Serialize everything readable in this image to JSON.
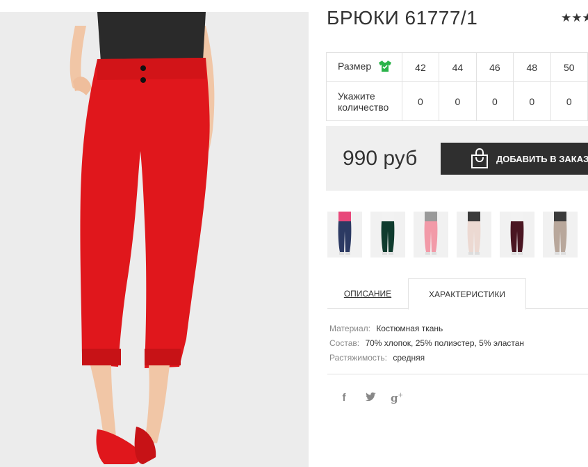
{
  "product": {
    "title": "БРЮКИ 61777/1",
    "rating_stars": "★★★"
  },
  "size_table": {
    "size_label": "Размер",
    "qty_label_line1": "Укажите",
    "qty_label_line2": "количество",
    "sizes": [
      "42",
      "44",
      "46",
      "48",
      "50"
    ],
    "quantities": [
      "0",
      "0",
      "0",
      "0",
      "0"
    ]
  },
  "price_panel": {
    "price": "990 руб",
    "add_button_label": "ДОБАВИТЬ В ЗАКАЗ"
  },
  "thumbnails": [
    {
      "name": "thumb-navy",
      "top_color": "#e8477a",
      "pants_color": "#2c3a63"
    },
    {
      "name": "thumb-green",
      "top_color": "#f2f2f2",
      "pants_color": "#0f3b2e"
    },
    {
      "name": "thumb-pink",
      "top_color": "#9a9a9a",
      "pants_color": "#f29aa8"
    },
    {
      "name": "thumb-beige",
      "top_color": "#3a3a3a",
      "pants_color": "#ecd9d2"
    },
    {
      "name": "thumb-burgundy",
      "top_color": "#f2f2f2",
      "pants_color": "#4a1622"
    },
    {
      "name": "thumb-taupe",
      "top_color": "#3a3a3a",
      "pants_color": "#b8a79b"
    }
  ],
  "tabs": {
    "description": "ОПИСАНИЕ",
    "characteristics": "ХАРАКТЕРИСТИКИ"
  },
  "specs": {
    "material_key": "Материал:",
    "material_value": "Костюмная ткань",
    "composition_key": "Состав:",
    "composition_value": "70% хлопок, 25% полиэстер, 5% эластан",
    "stretch_key": "Растяжимость:",
    "stretch_value": "средняя"
  },
  "social": {
    "facebook": "f",
    "twitter": "t",
    "googleplus": "g"
  },
  "colors": {
    "pants_red": "#e0171c",
    "top_black": "#2a2a2a",
    "button_dark": "#2f2f2f",
    "size_icon_green": "#2bb34a"
  }
}
